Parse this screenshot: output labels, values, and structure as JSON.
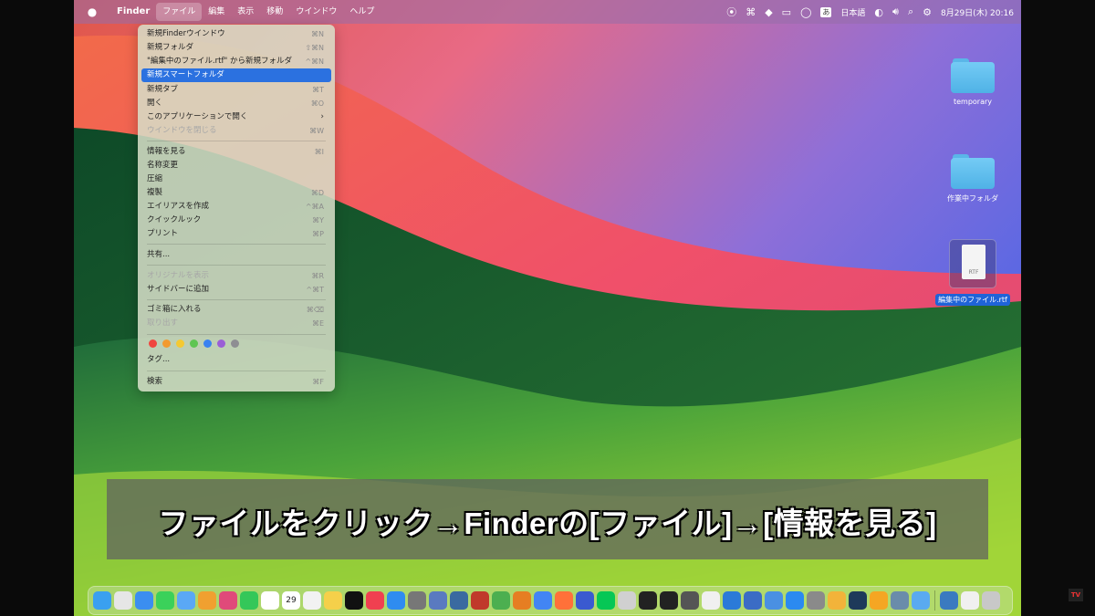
{
  "menubar": {
    "app_name": "Finder",
    "menus": [
      "ファイル",
      "編集",
      "表示",
      "移動",
      "ウインドウ",
      "ヘルプ"
    ],
    "ime_badge": "あ",
    "input_source": "日本語",
    "clock": "8月29日(木) 20:16"
  },
  "file_menu": {
    "items": [
      {
        "label": "新規Finderウインドウ",
        "shortcut": "⌘N"
      },
      {
        "label": "新規フォルダ",
        "shortcut": "⇧⌘N"
      },
      {
        "label": "\"編集中のファイル.rtf\" から新規フォルダ",
        "shortcut": "^⌘N"
      },
      {
        "label": "新規スマートフォルダ",
        "shortcut": ""
      },
      {
        "label": "新規タブ",
        "shortcut": "⌘T"
      },
      {
        "label": "開く",
        "shortcut": "⌘O"
      },
      {
        "label": "このアプリケーションで開く",
        "shortcut": "›"
      },
      {
        "label": "ウインドウを閉じる",
        "shortcut": "⌘W"
      },
      {
        "label": "情報を見る",
        "shortcut": "⌘I"
      },
      {
        "label": "名称変更",
        "shortcut": ""
      },
      {
        "label": "圧縮",
        "shortcut": ""
      },
      {
        "label": "複製",
        "shortcut": "⌘D"
      },
      {
        "label": "エイリアスを作成",
        "shortcut": "^⌘A"
      },
      {
        "label": "クイックルック",
        "shortcut": "⌘Y"
      },
      {
        "label": "プリント",
        "shortcut": "⌘P"
      },
      {
        "label": "共有...",
        "shortcut": ""
      },
      {
        "label": "オリジナルを表示",
        "shortcut": "⌘R"
      },
      {
        "label": "サイドバーに追加",
        "shortcut": "^⌘T"
      },
      {
        "label": "ゴミ箱に入れる",
        "shortcut": "⌘⌫"
      },
      {
        "label": "取り出す",
        "shortcut": "⌘E"
      },
      {
        "label": "タグ...",
        "shortcut": ""
      },
      {
        "label": "検索",
        "shortcut": "⌘F"
      }
    ],
    "highlighted_index": 3,
    "disabled_indices": [
      7,
      16,
      19
    ],
    "tag_colors": [
      "#f0463f",
      "#f29a2e",
      "#f5c932",
      "#5fc552",
      "#3a82f0",
      "#9a5fd6",
      "#8e8e93"
    ]
  },
  "desktop": {
    "items": [
      {
        "label": "temporary",
        "kind": "folder"
      },
      {
        "label": "作業中フォルダ",
        "kind": "folder"
      },
      {
        "label": "編集中のファイル.rtf",
        "kind": "rtf-document",
        "badge": "RTF",
        "selected": true
      }
    ]
  },
  "caption": {
    "text": "ファイルをクリック→Finderの[ファイル]→[情報を見る]"
  },
  "dock": {
    "calendar_day": "29",
    "app_colors": [
      "#3aa0f0",
      "#e6e6e6",
      "#3b8ef0",
      "#3bd15a",
      "#5aa8f5",
      "#f0a030",
      "#e04a7a",
      "#34c759",
      "#ffffff",
      "#9a7a50",
      "#f2f2f2",
      "#f5d04a",
      "#111111",
      "#f04050",
      "#2f8cf0",
      "#777777",
      "#5a7ac0",
      "#3a6aa0",
      "#c0392b",
      "#4caf50",
      "#e67e22",
      "#4285f4",
      "#ff7139",
      "#3a5ad0",
      "#06c755",
      "#d0d0d0",
      "#222222",
      "#222222",
      "#555555",
      "#f0f0f0",
      "#2b7ad8",
      "#3b6cc5",
      "#4a90e2",
      "#2b8af0",
      "#8a8a8a",
      "#f2b33a",
      "#1e3a5a",
      "#f5a623",
      "#6a8caa",
      "#5aaaf0",
      "#3a7ac0",
      "#f0f0f0",
      "#c8c8c8"
    ]
  }
}
